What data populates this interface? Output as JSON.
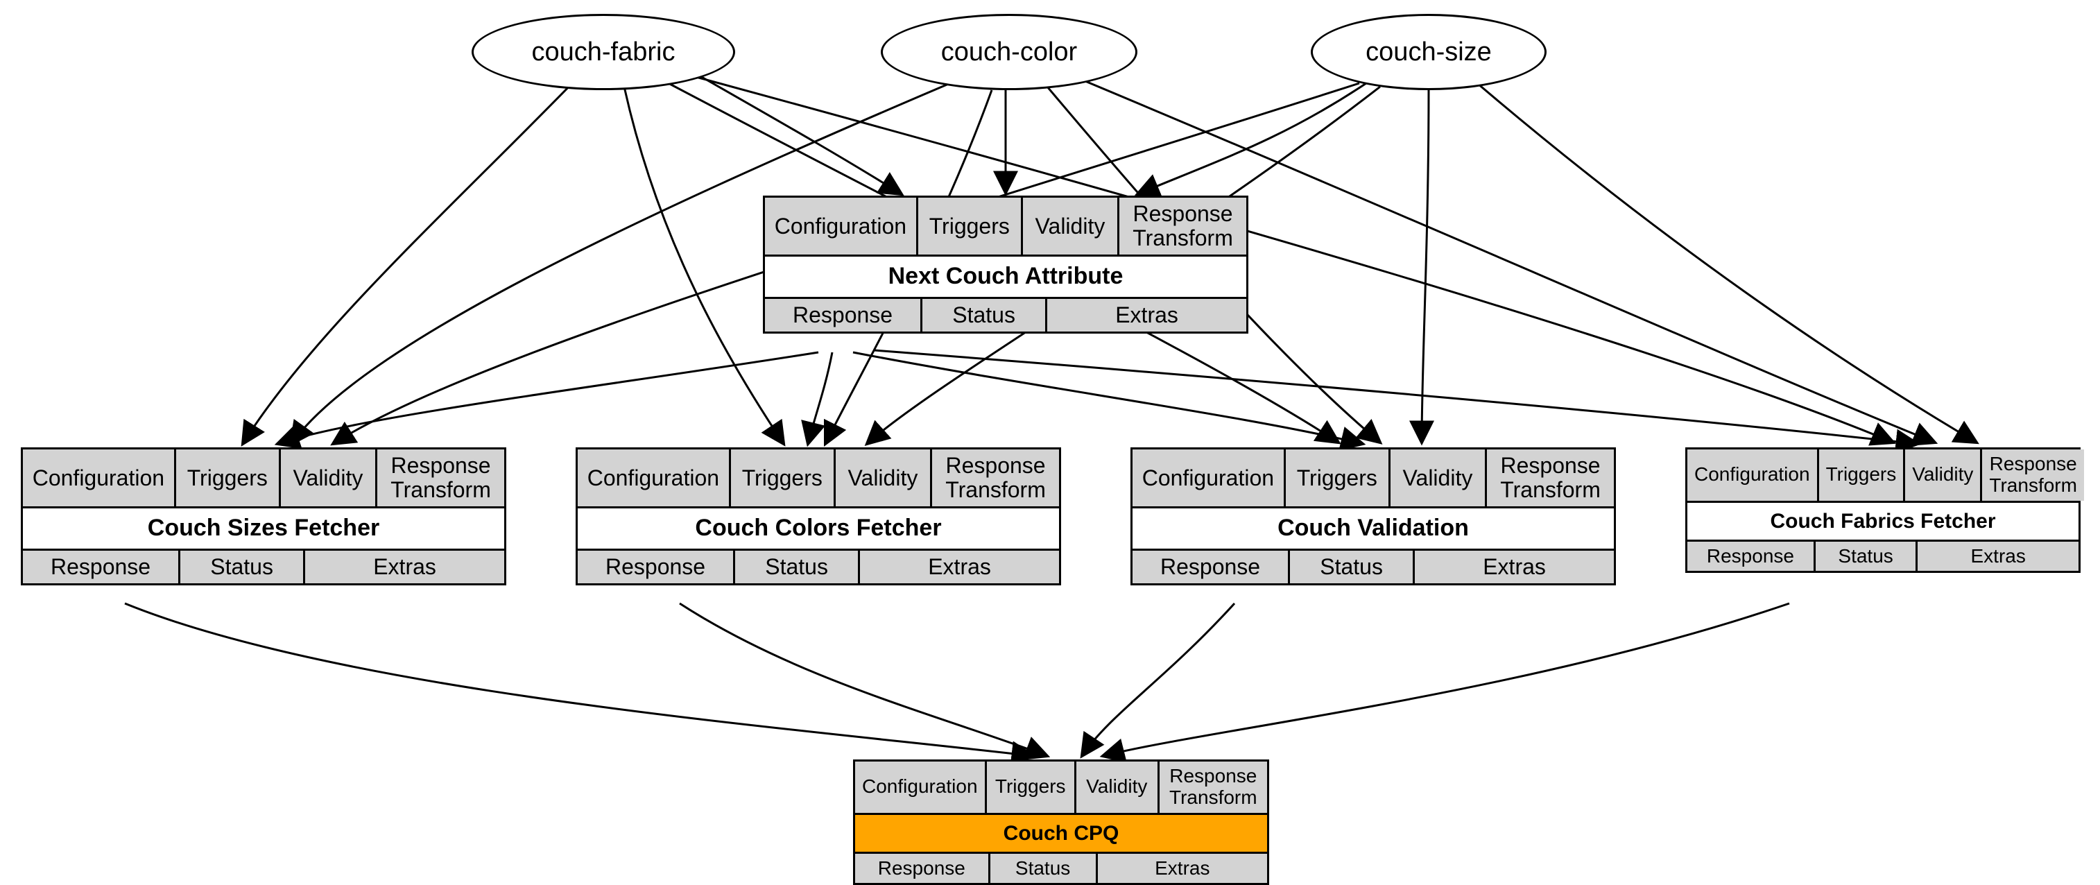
{
  "colors": {
    "cell_bg": "#d3d3d3",
    "highlight_bg": "#ffa500",
    "border": "#000000"
  },
  "top_row_labels": {
    "c1": "Configuration",
    "c2": "Triggers",
    "c3": "Validity",
    "c4": "Response Transform"
  },
  "bottom_row_labels": {
    "c1": "Response",
    "c2": "Status",
    "c3": "Extras"
  },
  "ellipses": {
    "fabric": "couch-fabric",
    "color": "couch-color",
    "size": "couch-size"
  },
  "nodes": {
    "next_attr": "Next Couch Attribute",
    "sizes": "Couch Sizes Fetcher",
    "colors": "Couch Colors Fetcher",
    "validation": "Couch Validation",
    "fabrics": "Couch Fabrics Fetcher",
    "cpq": "Couch CPQ"
  },
  "edges": [
    {
      "from": "fabric",
      "to": "next_attr"
    },
    {
      "from": "color",
      "to": "next_attr"
    },
    {
      "from": "size",
      "to": "next_attr"
    },
    {
      "from": "fabric",
      "to": "sizes"
    },
    {
      "from": "color",
      "to": "sizes"
    },
    {
      "from": "size",
      "to": "sizes"
    },
    {
      "from": "fabric",
      "to": "colors"
    },
    {
      "from": "color",
      "to": "colors"
    },
    {
      "from": "size",
      "to": "colors"
    },
    {
      "from": "fabric",
      "to": "validation"
    },
    {
      "from": "color",
      "to": "validation"
    },
    {
      "from": "size",
      "to": "validation"
    },
    {
      "from": "fabric",
      "to": "fabrics"
    },
    {
      "from": "color",
      "to": "fabrics"
    },
    {
      "from": "size",
      "to": "fabrics"
    },
    {
      "from": "next_attr",
      "to": "sizes"
    },
    {
      "from": "next_attr",
      "to": "colors"
    },
    {
      "from": "next_attr",
      "to": "validation"
    },
    {
      "from": "next_attr",
      "to": "fabrics"
    },
    {
      "from": "sizes",
      "to": "cpq"
    },
    {
      "from": "colors",
      "to": "cpq"
    },
    {
      "from": "validation",
      "to": "cpq"
    },
    {
      "from": "fabrics",
      "to": "cpq"
    }
  ]
}
